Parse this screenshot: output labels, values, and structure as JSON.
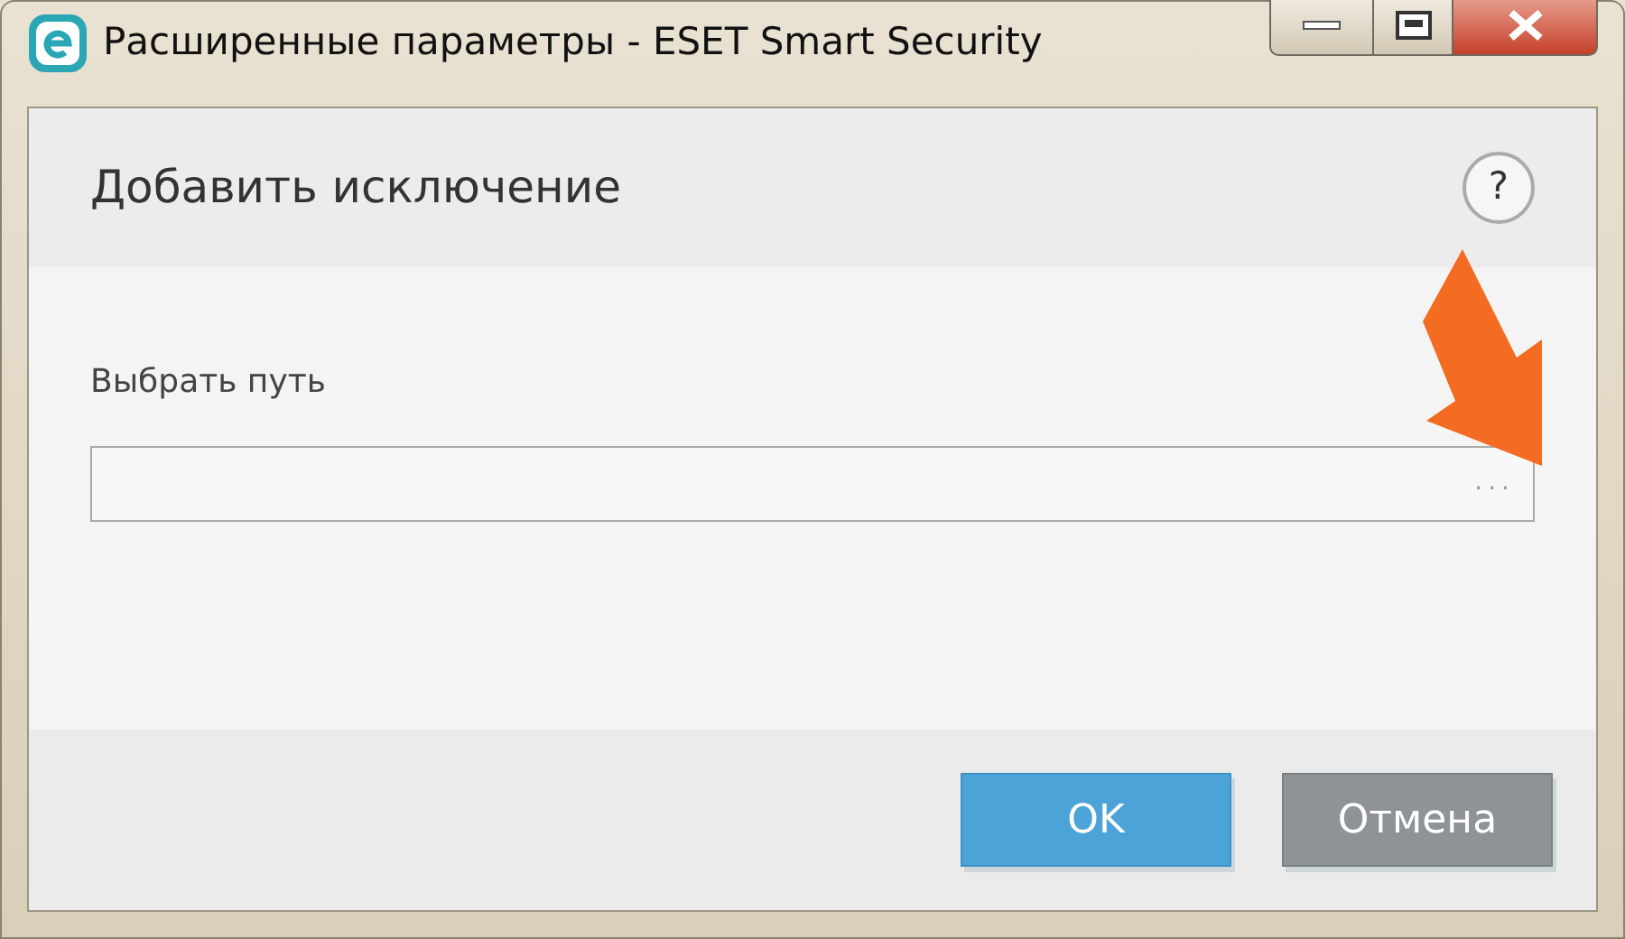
{
  "window": {
    "title": "Расширенные параметры - ESET Smart Security"
  },
  "dialog": {
    "heading": "Добавить исключение",
    "help": "?"
  },
  "path_field": {
    "label": "Выбрать путь",
    "browse": "..."
  },
  "buttons": [
    {
      "label": "OK",
      "kind": "primary"
    },
    {
      "label": "Отмена",
      "kind": "secondary"
    }
  ]
}
